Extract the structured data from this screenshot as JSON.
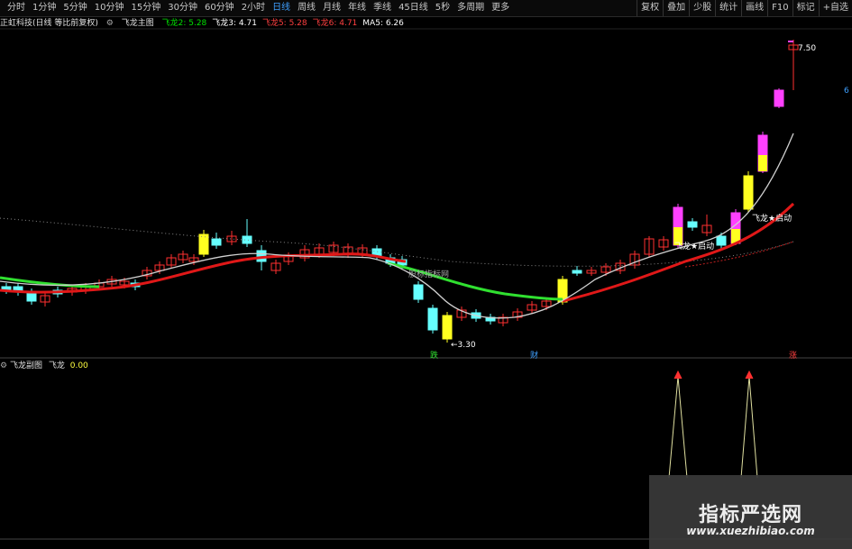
{
  "toolbar": {
    "periods": [
      "分时",
      "1分钟",
      "5分钟",
      "10分钟",
      "15分钟",
      "30分钟",
      "60分钟",
      "2小时",
      "日线",
      "周线",
      "月线",
      "年线",
      "季线",
      "45日线",
      "5秒",
      "多周期",
      "更多"
    ],
    "active_period": "日线",
    "right_items": [
      "复权",
      "叠加",
      "少股",
      "统计",
      "画线",
      "F10",
      "标记",
      "+自选"
    ]
  },
  "info_bar": {
    "stock": "正虹科技(日线 等比前复权)",
    "indicator": "飞龙主图",
    "labels": [
      {
        "text": "飞龙2: 5.28",
        "color": "#00e000"
      },
      {
        "text": "飞龙3: 4.71",
        "color": "#ffffff"
      },
      {
        "text": "飞龙5: 5.28",
        "color": "#ff4040"
      },
      {
        "text": "飞龙6: 4.71",
        "color": "#ff4040"
      },
      {
        "text": "MA5: 6.26",
        "color": "#ffffff"
      }
    ]
  },
  "main_chart": {
    "high_price_label": "7.50",
    "low_price_label": "3.30",
    "right_edge_label": "6",
    "signal_die": "跌",
    "signal_cai": "财",
    "signal_zhang": "涨",
    "launch_label_1": "飞龙★启动",
    "launch_label_2": "飞龙★启动",
    "watermark_text": "股标指标网"
  },
  "sub_chart": {
    "title": "飞龙副图",
    "series_name": "飞龙",
    "value": "0.00"
  },
  "site_watermark": {
    "title": "指标严选网",
    "url": "www.xuezhibiao.com"
  },
  "colors": {
    "up": "#ff3030",
    "down": "#66ffff",
    "magenta": "#ff40ff",
    "yellow": "#ffff20",
    "ma_red": "#e01818",
    "ma_green": "#30e030",
    "ma_white": "#d0d0d0",
    "active": "#3fa0ff"
  }
}
